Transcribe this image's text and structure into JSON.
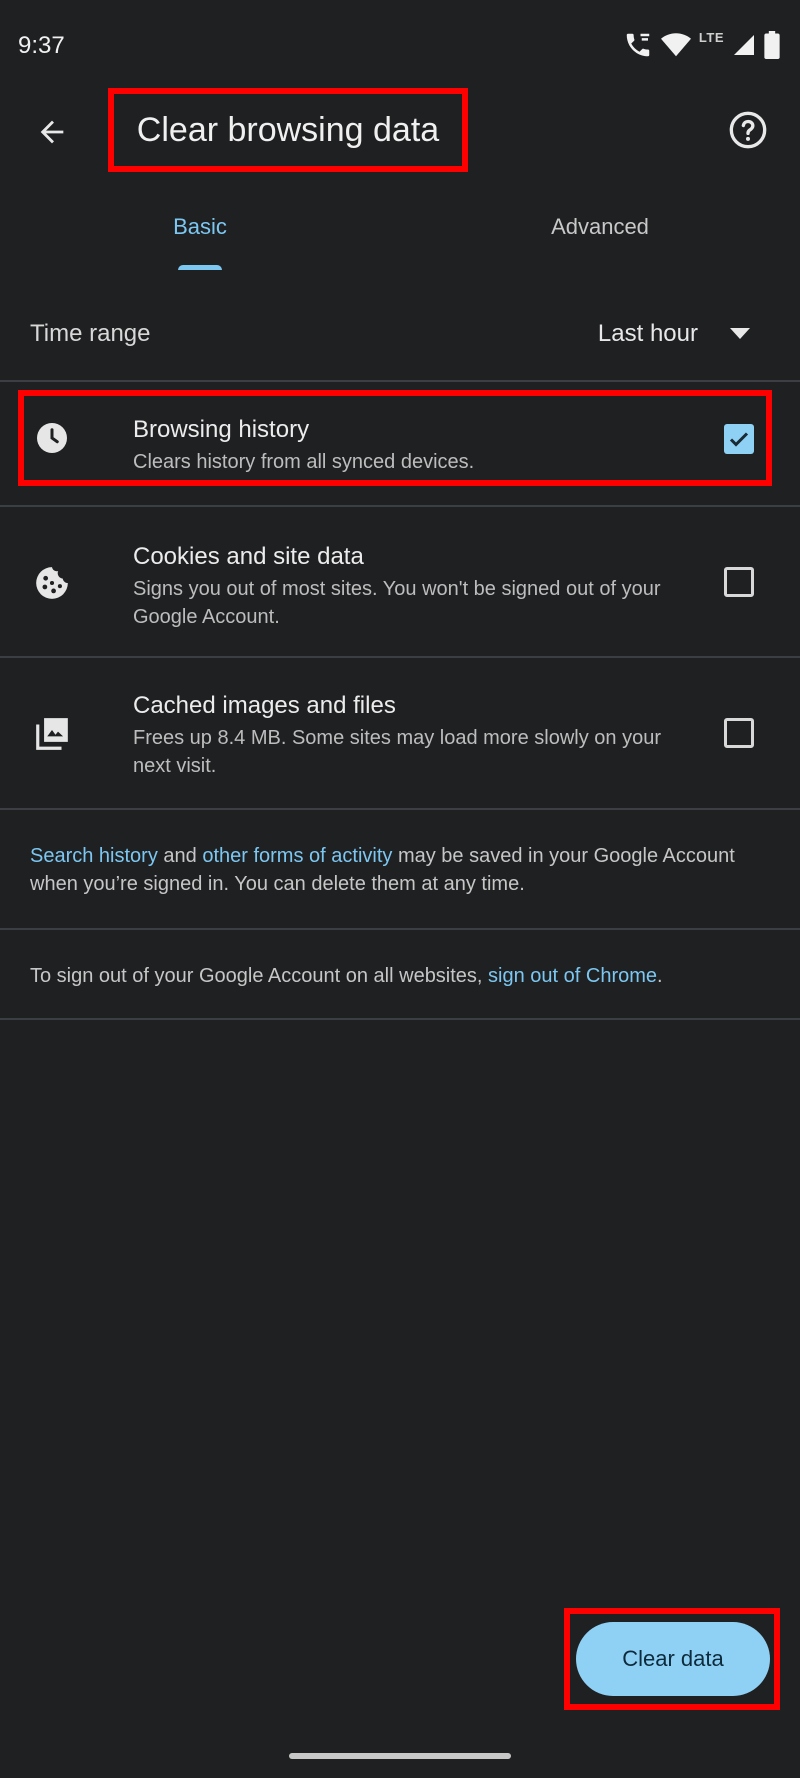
{
  "status_bar": {
    "time": "9:37",
    "network_label": "LTE",
    "icons": [
      "wifi-calling-icon",
      "wifi-icon",
      "cell-signal-icon",
      "battery-icon"
    ]
  },
  "app_bar": {
    "title": "Clear browsing data",
    "back_icon": "back-arrow-icon",
    "help_icon": "help-icon"
  },
  "tabs": [
    {
      "label": "Basic",
      "active": true
    },
    {
      "label": "Advanced",
      "active": false
    }
  ],
  "time_range": {
    "label": "Time range",
    "value": "Last hour"
  },
  "options": [
    {
      "title": "Browsing history",
      "subtitle": "Clears history from all synced devices.",
      "checked": true,
      "icon": "clock-icon"
    },
    {
      "title": "Cookies and site data",
      "subtitle": "Signs you out of most sites. You won't be signed out of your Google Account.",
      "checked": false,
      "icon": "cookie-icon"
    },
    {
      "title": "Cached images and files",
      "subtitle": "Frees up 8.4 MB. Some sites may load more slowly on your next visit.",
      "checked": false,
      "icon": "images-icon"
    }
  ],
  "info": {
    "activity": {
      "link1": "Search history",
      "text1": " and ",
      "link2": "other forms of activity",
      "text2": " may be saved in your Google Account when you’re signed in. You can delete them at any time."
    },
    "signout": {
      "text": "To sign out of your Google Account on all websites, ",
      "link": "sign out of Chrome",
      "suffix": "."
    }
  },
  "clear_button": {
    "label": "Clear data"
  },
  "colors": {
    "background": "#1f2022",
    "accent": "#7cc7f2",
    "button": "#8fd0f5",
    "highlight": "#ff0000"
  }
}
